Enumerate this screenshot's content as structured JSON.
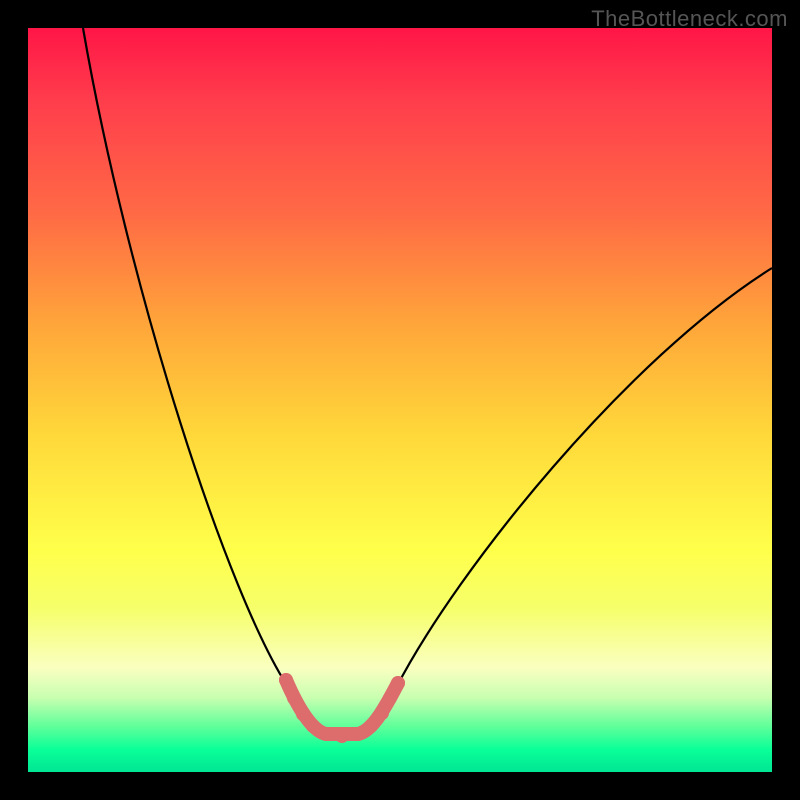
{
  "watermark": "TheBottleneck.com",
  "colors": {
    "frame_bg": "#000000",
    "curve": "#000000",
    "highlight": "#dd6d6d",
    "gradient_top": "#ff1647",
    "gradient_mid": "#ffff4a",
    "gradient_bottom": "#00e693"
  },
  "chart_data": {
    "type": "line",
    "title": "",
    "xlabel": "",
    "ylabel": "",
    "xlim": [
      0,
      100
    ],
    "ylim": [
      0,
      100
    ],
    "grid": false,
    "legend": false,
    "description": "V-shaped bottleneck curve over rainbow gradient; y≈0 is optimum (green), y≈100 is worst (red). Highlighted segment marks the minimum region.",
    "series": [
      {
        "name": "bottleneck-curve",
        "x": [
          7,
          12,
          18,
          24,
          30,
          35,
          40,
          44,
          50,
          56,
          62,
          70,
          80,
          90,
          100
        ],
        "y": [
          100,
          78,
          58,
          42,
          28,
          16,
          8,
          5,
          6,
          14,
          26,
          40,
          54,
          62,
          68
        ]
      },
      {
        "name": "highlight-minimum",
        "x": [
          35,
          37,
          39,
          41,
          43,
          45,
          47,
          49,
          50
        ],
        "y": [
          12,
          9,
          6,
          5,
          5,
          5,
          7,
          10,
          12
        ]
      }
    ]
  }
}
